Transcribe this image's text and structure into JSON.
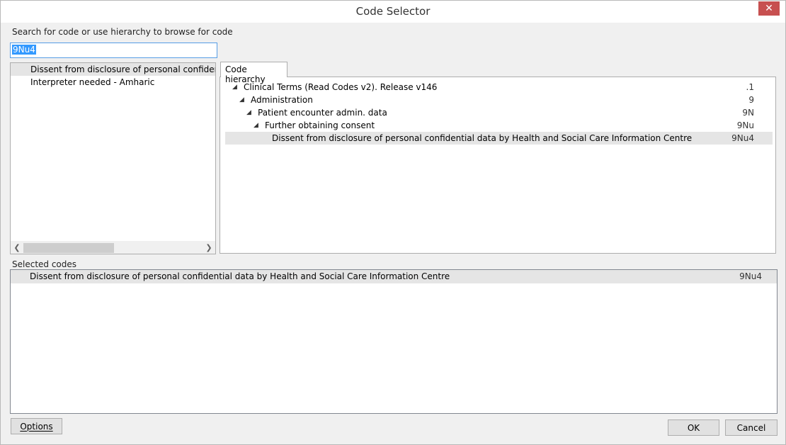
{
  "window": {
    "title": "Code Selector",
    "close_label": "✕"
  },
  "search": {
    "label": "Search for code or use hierarchy to browse for code",
    "value": "9Nu4"
  },
  "results": {
    "items": [
      {
        "label": "Dissent from disclosure of personal confidentia",
        "selected": true
      },
      {
        "label": "Interpreter needed - Amharic",
        "selected": false
      }
    ],
    "scroll_left_icon": "chevron-left-icon",
    "scroll_right_icon": "chevron-right-icon"
  },
  "tabs": [
    {
      "label": "Code hierarchy",
      "active": true
    }
  ],
  "hierarchy": {
    "rows": [
      {
        "label": "Clinical Terms (Read Codes v2). Release v146",
        "code": ".1",
        "expanded": true
      },
      {
        "label": "Administration",
        "code": "9",
        "expanded": true
      },
      {
        "label": "Patient encounter admin. data",
        "code": "9N",
        "expanded": true
      },
      {
        "label": "Further obtaining consent",
        "code": "9Nu",
        "expanded": true
      },
      {
        "label": "Dissent from disclosure of personal confidential data by Health and Social Care Information Centre",
        "code": "9Nu4",
        "expanded": false
      }
    ]
  },
  "selected_codes": {
    "label": "Selected codes",
    "items": [
      {
        "label": "Dissent from disclosure of personal confidential data by Health and Social Care Information Centre",
        "code": "9Nu4"
      }
    ]
  },
  "buttons": {
    "options_label": "Options",
    "ok_label": "OK",
    "cancel_label": "Cancel"
  }
}
